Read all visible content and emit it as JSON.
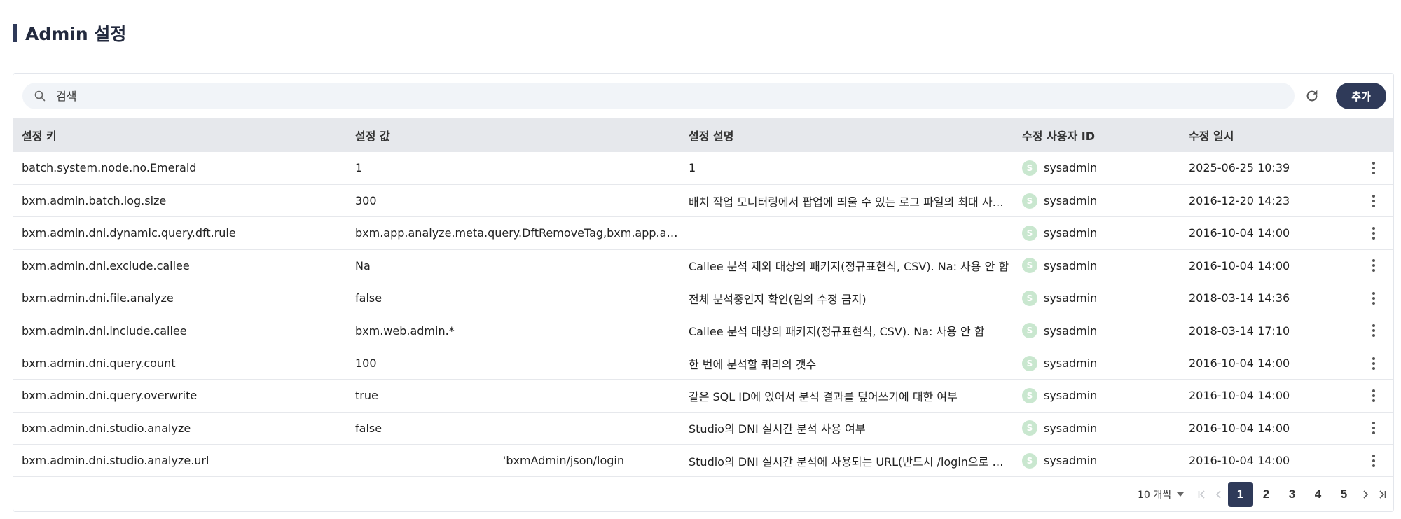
{
  "page": {
    "title": "Admin 설정"
  },
  "toolbar": {
    "search_placeholder": "검색",
    "add_label": "추가"
  },
  "table": {
    "headers": [
      "설정 키",
      "설정 값",
      "설정 설명",
      "수정 사용자 ID",
      "수정 일시"
    ],
    "rows": [
      {
        "key": "batch.system.node.no.Emerald",
        "value": "1",
        "description": "1",
        "user": "sysadmin",
        "avatar": "S",
        "updated": "2025-06-25 10:39"
      },
      {
        "key": "bxm.admin.batch.log.size",
        "value": "300",
        "description": "배치 작업 모니터링에서 팝업에 띄울 수 있는 로그 파일의 최대 사이…",
        "user": "sysadmin",
        "avatar": "S",
        "updated": "2016-12-20 14:23"
      },
      {
        "key": "bxm.admin.dni.dynamic.query.dft.rule",
        "value": "bxm.app.analyze.meta.query.DftRemoveTag,bxm.app.analy…",
        "description": "",
        "user": "sysadmin",
        "avatar": "S",
        "updated": "2016-10-04 14:00"
      },
      {
        "key": "bxm.admin.dni.exclude.callee",
        "value": "Na",
        "description": "Callee 분석 제외 대상의 패키지(정규표현식, CSV). Na: 사용 안 함",
        "user": "sysadmin",
        "avatar": "S",
        "updated": "2016-10-04 14:00"
      },
      {
        "key": "bxm.admin.dni.file.analyze",
        "value": "false",
        "description": "전체 분석중인지 확인(임의 수정 금지)",
        "user": "sysadmin",
        "avatar": "S",
        "updated": "2018-03-14 14:36"
      },
      {
        "key": "bxm.admin.dni.include.callee",
        "value": "bxm.web.admin.*",
        "description": "Callee 분석 대상의 패키지(정규표현식, CSV). Na: 사용 안 함",
        "user": "sysadmin",
        "avatar": "S",
        "updated": "2018-03-14 17:10"
      },
      {
        "key": "bxm.admin.dni.query.count",
        "value": "100",
        "description": "한 번에 분석할 쿼리의 갯수",
        "user": "sysadmin",
        "avatar": "S",
        "updated": "2016-10-04 14:00"
      },
      {
        "key": "bxm.admin.dni.query.overwrite",
        "value": "true",
        "description": "같은 SQL ID에 있어서 분석 결과를 덮어쓰기에 대한 여부",
        "user": "sysadmin",
        "avatar": "S",
        "updated": "2016-10-04 14:00"
      },
      {
        "key": "bxm.admin.dni.studio.analyze",
        "value": "false",
        "description": "Studio의 DNI 실시간 분석 사용 여부",
        "user": "sysadmin",
        "avatar": "S",
        "updated": "2016-10-04 14:00"
      },
      {
        "key": "bxm.admin.dni.studio.analyze.url",
        "value": "'bxmAdmin/json/login",
        "description": "Studio의 DNI 실시간 분석에 사용되는 URL(반드시 /login으로 끝…",
        "user": "sysadmin",
        "avatar": "S",
        "updated": "2016-10-04 14:00"
      }
    ]
  },
  "pagination": {
    "page_size_label": "10 개씩",
    "pages": [
      "1",
      "2",
      "3",
      "4",
      "5"
    ],
    "current_page": "1",
    "first": "|‹",
    "prev": "‹",
    "next": "›",
    "last": "›|"
  },
  "colors": {
    "accent": "#2f3a59",
    "avatar_bg": "#c9e7cf",
    "header_bg": "#e6e8ec",
    "search_bg": "#f1f4f8"
  },
  "icons": {
    "search": "search-icon",
    "refresh": "refresh-icon",
    "row_menu": "more-vertical-icon"
  }
}
